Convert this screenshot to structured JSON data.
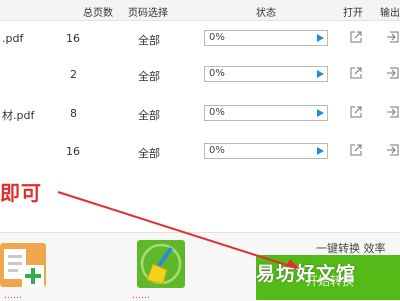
{
  "header": {
    "total_pages": "总页数",
    "page_select": "页码选择",
    "status": "状态",
    "open": "打开",
    "export": "输出"
  },
  "files": [
    {
      "name": ".pdf",
      "pages": "16",
      "range": "全部",
      "progress": "0%"
    },
    {
      "name": "",
      "pages": "2",
      "range": "全部",
      "progress": "0%"
    },
    {
      "name": "材.pdf",
      "pages": "8",
      "range": "全部",
      "progress": "0%"
    },
    {
      "name": "",
      "pages": "16",
      "range": "全部",
      "progress": "0%"
    }
  ],
  "annotation": {
    "text": "即可"
  },
  "bottom": {
    "one_click": "一键转换 效率",
    "convert_button": "开始转换",
    "tool1_label": "……",
    "tool2_label": "……"
  },
  "watermark": "易坊好文馆",
  "colors": {
    "accent_blue": "#2b8ad8",
    "convert_green": "#54ba18",
    "annotation_red": "#e0302e"
  },
  "icons": {
    "play": "play-icon",
    "open": "external-link-icon",
    "export": "export-icon",
    "folder_add": "folder-add-icon",
    "clean": "broom-icon"
  }
}
